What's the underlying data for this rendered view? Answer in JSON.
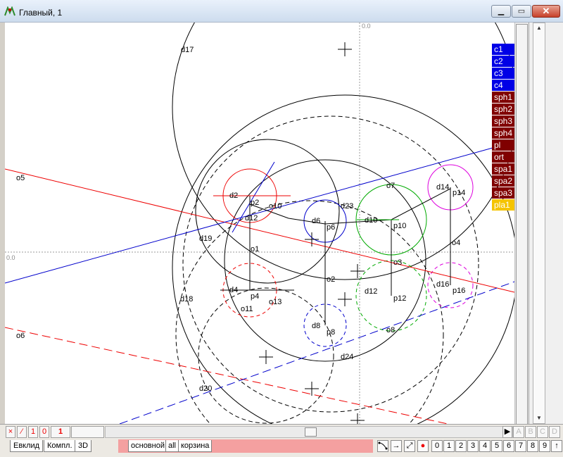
{
  "window": {
    "title": "Главный, 1"
  },
  "layers": [
    {
      "label": "c1",
      "color": "blue"
    },
    {
      "label": "c2",
      "color": "blue"
    },
    {
      "label": "c3",
      "color": "blue"
    },
    {
      "label": "c4",
      "color": "blue"
    },
    {
      "label": "sph1",
      "color": "dred"
    },
    {
      "label": "sph2",
      "color": "dred"
    },
    {
      "label": "sph3",
      "color": "dred"
    },
    {
      "label": "sph4",
      "color": "dred"
    },
    {
      "label": "pl",
      "color": "dred"
    },
    {
      "label": "ort",
      "color": "dred"
    },
    {
      "label": "spa1",
      "color": "dred"
    },
    {
      "label": "spa2",
      "color": "dred"
    },
    {
      "label": "spa3",
      "color": "dred"
    },
    {
      "label": "pla1",
      "color": "yellow"
    }
  ],
  "axes": {
    "x_origin_label": "0.0",
    "y_origin_label": "0.0"
  },
  "labels": {
    "d17": "d17",
    "o5": "o5",
    "o6": "o6",
    "d2": "d2",
    "p2": "p2",
    "o10": "o10",
    "d12a": "d12",
    "d19": "d19",
    "d6": "d6",
    "p6": "p6",
    "d23": "d23",
    "o7": "o7",
    "d10": "d10",
    "p10": "p10",
    "d14": "d14",
    "p14": "p14",
    "o1": "o1",
    "o4": "o4",
    "o3": "o3",
    "d4": "d4",
    "p4": "p4",
    "o11": "o11",
    "o13": "o13",
    "o2": "o2",
    "d12b": "d12",
    "p12": "p12",
    "d16": "d16",
    "p16": "p16",
    "d18": "d18",
    "d8": "d8",
    "p8": "p8",
    "o8": "o8",
    "d24": "d24",
    "d20": "d20"
  },
  "bottom": {
    "small_buttons": [
      "×",
      "⁄",
      "1",
      "0"
    ],
    "counter": "1",
    "left_tabs": [
      "Евклид",
      "Компл.",
      "3D"
    ],
    "page_tabs": [
      "основной",
      "all",
      "корзина"
    ],
    "right_letters": [
      "A",
      "B",
      "C",
      "D"
    ],
    "num_buttons": [
      "0",
      "1",
      "2",
      "3",
      "4",
      "5",
      "6",
      "7",
      "8",
      "9",
      "↑"
    ],
    "tool_icons": [
      "curve-tool-icon",
      "arrow-right-icon",
      "diagonal-arrow-icon",
      "record-dot-icon"
    ]
  },
  "colors": {
    "accent_blue": "#0000e6",
    "layer_dark_red": "#800000",
    "layer_yellow": "#f5c400",
    "tab_zone": "#f4a0a0"
  }
}
